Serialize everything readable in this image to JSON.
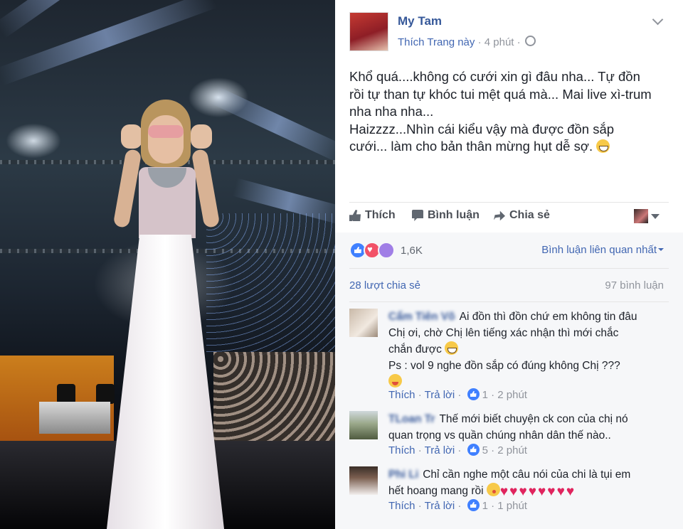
{
  "post": {
    "author": "My Tam",
    "page_action": "Thích Trang này",
    "separator": "·",
    "time": "4 phút",
    "body_lines": [
      "Khổ quá....không có cưới xin gì đâu nha... Tự đồn",
      "rồi tự than tự khóc tui mệt quá mà... Mai live xì-trum",
      "nha nha nha...",
      "Haizzzz...Nhìn cái kiểu vậy mà được đồn sắp",
      "cưới... làm cho bản thân mừng hụt dễ sợ."
    ],
    "body_emoji": "grinning-squinting-face"
  },
  "actions": {
    "like": "Thích",
    "comment": "Bình luận",
    "share": "Chia sẻ"
  },
  "stats": {
    "reaction_count": "1,6K",
    "reaction_types": [
      "like",
      "love",
      "wow"
    ],
    "sort_label": "Bình luận liên quan nhất",
    "shares": "28 lượt chia sẻ",
    "comments": "97 bình luận"
  },
  "comments": [
    {
      "name": "Cẩm Tiên Võ",
      "lines": [
        "Ai đồn thì đồn chứ em không tin đâu",
        "Chị ơi, chờ Chị lên tiếng xác nhận thì mới chắc",
        "chắn được",
        "Ps : vol 9 nghe đồn sắp có đúng không Chị ???"
      ],
      "like_label": "Thích",
      "reply_label": "Trả lời",
      "likes": "1",
      "time": "2 phút"
    },
    {
      "name": "TLoan Tr",
      "lines": [
        "Thế mới biết chuyện ck con của chị nó",
        "quan trọng vs quần chúng nhân dân thế nào.."
      ],
      "like_label": "Thích",
      "reply_label": "Trả lời",
      "likes": "5",
      "time": "2 phút"
    },
    {
      "name": "Phi Li",
      "lines": [
        "Chỉ cần nghe một câu nói của chi là tụi em",
        "hết hoang mang rồi"
      ],
      "like_label": "Thích",
      "reply_label": "Trả lời",
      "likes": "1",
      "time": "1 phút"
    }
  ],
  "colors": {
    "link_blue": "#4267b2",
    "name_blue": "#365899",
    "meta_gray": "#90949c",
    "like_blue": "#4080ff",
    "love_red": "#f25268",
    "heart_red": "#e0245e"
  }
}
